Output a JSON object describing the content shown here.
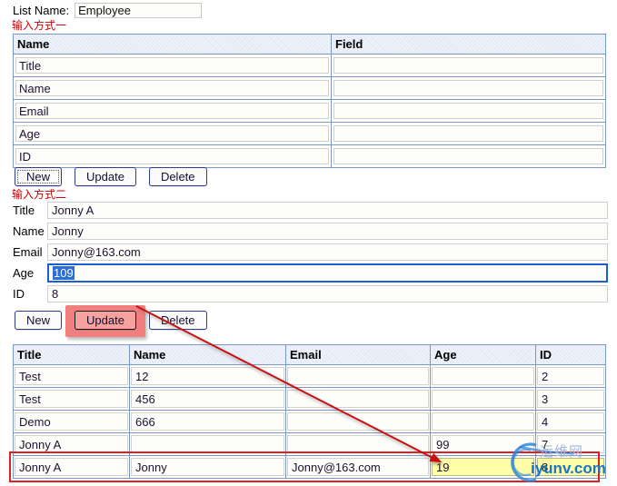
{
  "header": {
    "list_name_label": "List Name:",
    "list_name_value": "Employee"
  },
  "section_one": {
    "caption": "输入方式一",
    "table": {
      "columns": [
        "Name",
        "Field"
      ],
      "rows": [
        {
          "name": "Title",
          "field": ""
        },
        {
          "name": "Name",
          "field": ""
        },
        {
          "name": "Email",
          "field": ""
        },
        {
          "name": "Age",
          "field": ""
        },
        {
          "name": "ID",
          "field": ""
        }
      ]
    },
    "buttons": {
      "new": "New",
      "update": "Update",
      "delete": "Delete"
    }
  },
  "section_two": {
    "caption": "输入方式二",
    "fields": [
      {
        "label": "Title",
        "value": "Jonny A",
        "focused": false,
        "selected": false
      },
      {
        "label": "Name",
        "value": "Jonny",
        "focused": false,
        "selected": false
      },
      {
        "label": "Email",
        "value": "Jonny@163.com",
        "focused": false,
        "selected": false
      },
      {
        "label": "Age",
        "value": "109",
        "focused": true,
        "selected": true
      },
      {
        "label": "ID",
        "value": "8",
        "focused": false,
        "selected": false
      }
    ],
    "buttons": {
      "new": "New",
      "update": "Update",
      "delete": "Delete"
    }
  },
  "results": {
    "columns": [
      "Title",
      "Name",
      "Email",
      "Age",
      "ID"
    ],
    "rows": [
      {
        "title": "Test",
        "name": "12",
        "email": "",
        "age": "",
        "id": "2"
      },
      {
        "title": "Test",
        "name": "456",
        "email": "",
        "age": "",
        "id": "3"
      },
      {
        "title": "Demo",
        "name": "666",
        "email": "",
        "age": "",
        "id": "4"
      },
      {
        "title": "Jonny A",
        "name": "",
        "email": "",
        "age": "99",
        "id": "7"
      },
      {
        "title": "Jonny A",
        "name": "Jonny",
        "email": "Jonny@163.com",
        "age": "19",
        "id": "8"
      }
    ]
  },
  "watermark": {
    "chinese": "运维网",
    "domain": "iyunv.com"
  },
  "colors": {
    "annotation_red": "#e02020",
    "highlight_pink": "#f08080",
    "highlight_yellow": "#ffffa8",
    "selection_blue": "#2a6ed6",
    "caption_red": "#cc0000",
    "table_border": "#7a97c9",
    "header_bg": "#e4eaf6",
    "watermark_blue": "#1a74c8"
  }
}
